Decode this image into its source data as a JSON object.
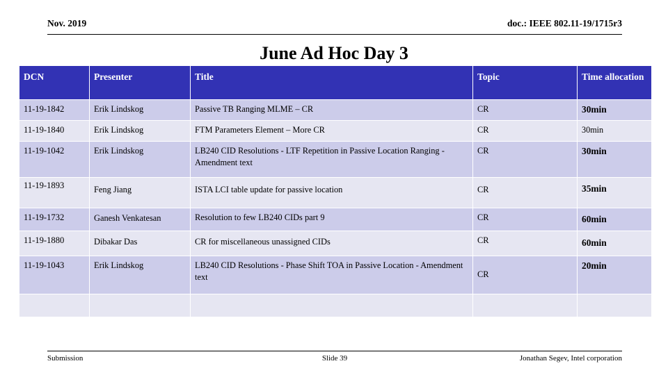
{
  "slide": {
    "header_left": "Nov. 2019",
    "header_right": "doc.: IEEE 802.11-19/1715r3",
    "title": "June Ad Hoc Day 3",
    "footer_left": "Submission",
    "footer_center": "Slide 39",
    "footer_right": "Jonathan Segev, Intel corporation"
  },
  "colors": {
    "header_blue": "#3232b4",
    "row_dark": "#ccccea",
    "row_light": "#e6e6f2",
    "text": "#000000",
    "header_text": "#ffffff"
  },
  "table": {
    "columns": [
      {
        "key": "dcn",
        "label": "DCN"
      },
      {
        "key": "pres",
        "label": "Presenter"
      },
      {
        "key": "title",
        "label": "Title"
      },
      {
        "key": "topic",
        "label": "Topic"
      },
      {
        "key": "time",
        "label": "Time allocation"
      }
    ],
    "rows": [
      {
        "dcn": "11-19-1842",
        "pres": "Erik Lindskog",
        "title": "Passive TB Ranging MLME – CR",
        "topic": "CR",
        "time": "30min"
      },
      {
        "dcn": "11-19-1840",
        "pres": "Erik Lindskog",
        "title": "FTM Parameters Element – More CR",
        "topic": "CR",
        "time": "30min"
      },
      {
        "dcn": "11-19-1042",
        "pres": "Erik Lindskog",
        "title": "LB240 CID Resolutions - LTF Repetition in Passive Location Ranging - Amendment text",
        "topic": "CR",
        "time": "30min"
      },
      {
        "dcn": "11-19-1893",
        "pres": "Feng Jiang",
        "title": "ISTA LCI table update for passive location",
        "topic": "CR",
        "time": "35min"
      },
      {
        "dcn": "11-19-1732",
        "pres": "Ganesh Venkatesan",
        "title": "Resolution to few LB240 CIDs part 9",
        "topic": "CR",
        "time": "60min"
      },
      {
        "dcn": "11-19-1880",
        "pres": "Dibakar Das",
        "title": "CR for miscellaneous unassigned CIDs",
        "topic": "CR",
        "time": "60min"
      },
      {
        "dcn": "11-19-1043",
        "pres": "Erik Lindskog",
        "title": "LB240 CID Resolutions - Phase Shift TOA in Passive Location - Amendment text",
        "topic": "CR",
        "time": "20min"
      },
      {
        "dcn": "",
        "pres": "",
        "title": "",
        "topic": "",
        "time": ""
      }
    ]
  }
}
